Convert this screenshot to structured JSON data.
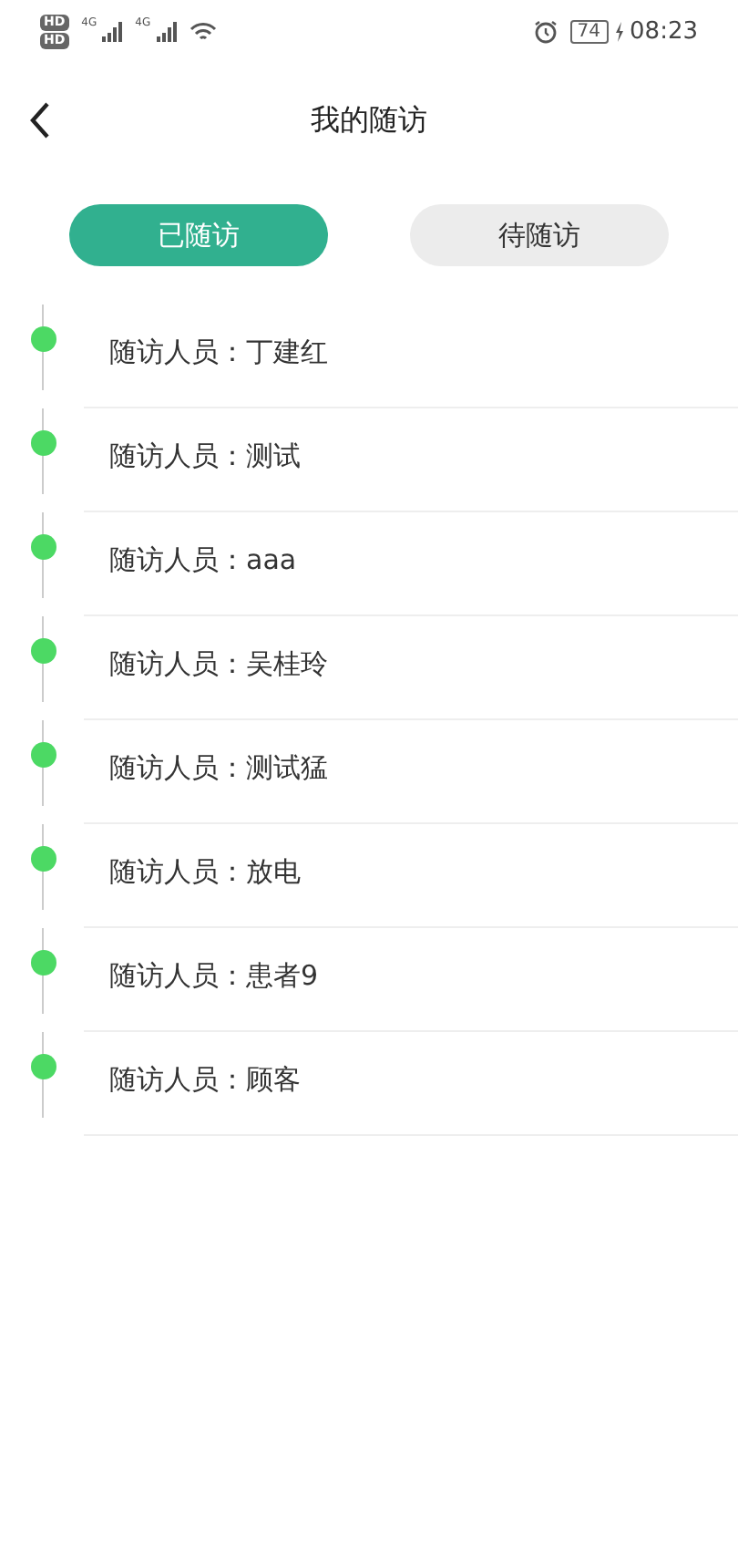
{
  "status_bar": {
    "sim_labels": [
      "HD",
      "HD"
    ],
    "network_labels": [
      "4G",
      "4G"
    ],
    "battery": "74",
    "time": "08:23"
  },
  "header": {
    "title": "我的随访"
  },
  "tabs": [
    {
      "label": "已随访",
      "selected": true
    },
    {
      "label": "待随访",
      "selected": false
    }
  ],
  "visits": [
    {
      "text": "随访人员：丁建红"
    },
    {
      "text": "随访人员：测试"
    },
    {
      "text": "随访人员：aaa"
    },
    {
      "text": "随访人员：吴桂玲"
    },
    {
      "text": "随访人员：测试猛"
    },
    {
      "text": "随访人员：放电"
    },
    {
      "text": "随访人员：患者9"
    },
    {
      "text": "随访人员：顾客"
    }
  ]
}
